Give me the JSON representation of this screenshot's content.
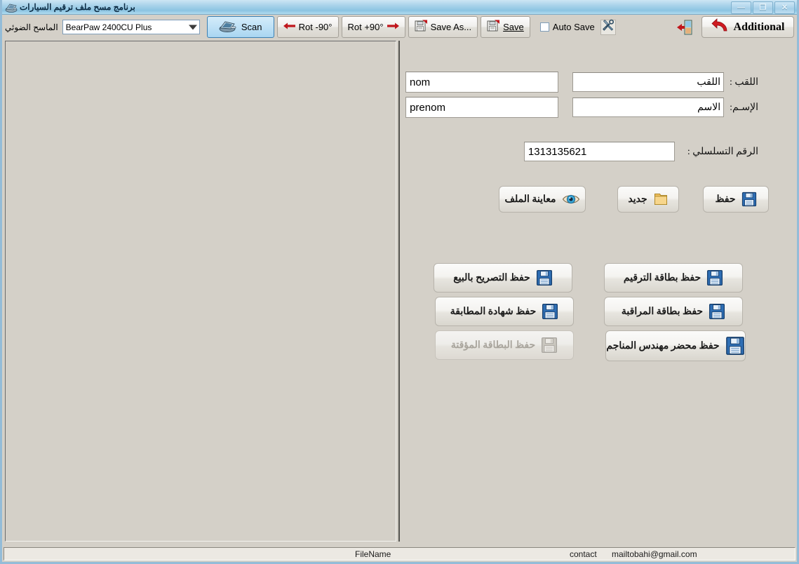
{
  "window": {
    "title": "برنامج مسح ملف ترقيم السيارات",
    "title_icon": "scanner-icon",
    "controls": {
      "minimize": "—",
      "maximize": "❐",
      "close": "✕"
    }
  },
  "toolbar": {
    "scanner_label": "الماسح الضوئي",
    "scanner_select": {
      "value": "BearPaw 2400CU Plus",
      "options": [
        "BearPaw 2400CU Plus"
      ],
      "icon": "chevron-down-icon"
    },
    "scan_button": {
      "label": "Scan",
      "icon": "scanner-icon"
    },
    "rotate_left_button": {
      "label": "Rot -90°",
      "icon": "arrow-left-icon"
    },
    "rotate_right_button": {
      "label": "Rot +90°",
      "icon": "arrow-right-icon"
    },
    "save_as_button": {
      "label": "Save As...",
      "icon": "save-as-icon"
    },
    "save_button": {
      "label": "Save",
      "icon": "save-icon"
    },
    "auto_save": {
      "label": "Auto Save",
      "checked": false
    },
    "tools_button": {
      "icon": "tools-icon"
    },
    "exit_button": {
      "icon": "exit-door-icon"
    },
    "additional_button": {
      "label": "Additional",
      "icon": "undo-arrow-icon"
    }
  },
  "form": {
    "fields": [
      {
        "label": "اللقب :",
        "rtl_input_value": "اللقب",
        "ltr_input_value": "nom",
        "ltr_placeholder": "nom"
      },
      {
        "label": "الإسـم:",
        "rtl_input_value": "الاسم",
        "ltr_input_value": "prenom",
        "ltr_placeholder": "prenom"
      }
    ],
    "serial": {
      "label": "الرقم التسلسلي :",
      "value": "1313135621",
      "placeholder": ""
    },
    "primary_actions": [
      {
        "label": "حفظ",
        "icon": "floppy-save-icon",
        "enabled": true
      },
      {
        "label": "جديد",
        "icon": "folder-new-icon",
        "enabled": true
      },
      {
        "label": "معاينة الملف",
        "icon": "eye-preview-icon",
        "enabled": true
      }
    ],
    "save_actions_right": [
      {
        "label": "حفظ بطاقة الترقيم",
        "icon": "floppy-save-icon",
        "enabled": true
      },
      {
        "label": "حفظ بطاقة المراقبة",
        "icon": "floppy-save-icon",
        "enabled": true
      },
      {
        "label": "حفظ  محضر مهندس المناجم",
        "icon": "floppy-save-icon",
        "enabled": true
      }
    ],
    "save_actions_left": [
      {
        "label": "حفظ  التصريح بالبيع",
        "icon": "floppy-save-icon",
        "enabled": true
      },
      {
        "label": "حفظ  شهادة المطابقة",
        "icon": "floppy-save-icon",
        "enabled": true
      },
      {
        "label": "حفظ  البطاقة المؤقتة",
        "icon": "floppy-save-icon",
        "enabled": false
      }
    ]
  },
  "status_bar": {
    "filename": "FileName",
    "contact_label": "contact",
    "contact_value": "mailtobahi@gmail.com"
  },
  "colors": {
    "window_frame": "#94bcd8",
    "titlebar_accent": "#8cc4e2",
    "face": "#d4d0c8",
    "scan_highlight": "#bfe1f6",
    "scan_border": "#3c7fb1",
    "floppy_blue": "#2f6fb5",
    "arrow_red": "#c0161c"
  }
}
